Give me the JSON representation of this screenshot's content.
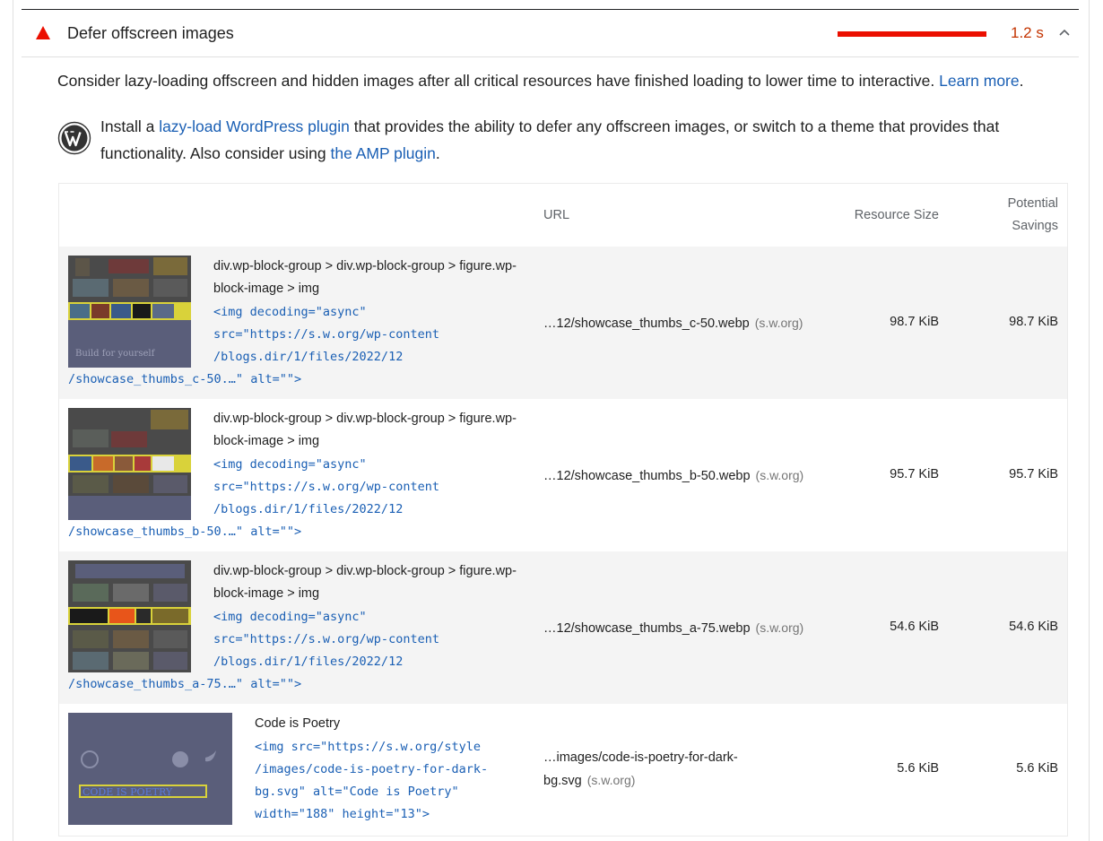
{
  "audit": {
    "title": "Defer offscreen images",
    "metric": "1.2 s",
    "description": "Consider lazy-loading offscreen and hidden images after all critical resources have finished loading to lower time to interactive.",
    "learn_more": "Learn more",
    "period": "."
  },
  "wordpress": {
    "text1": "Install a ",
    "link1": "lazy-load WordPress plugin",
    "text2": " that provides the ability to defer any offscreen images, or switch to a theme that provides that functionality. Also consider using ",
    "link2": "the AMP plugin",
    "text3": "."
  },
  "table": {
    "headers": {
      "url": "URL",
      "size": "Resource Size",
      "savings_line1": "Potential",
      "savings_line2": "Savings"
    },
    "rows": [
      {
        "selector_line1": "div.wp-block-group > div.wp-block-group > figure.wp-",
        "selector_line2": "block-image > img",
        "code_lines": [
          "<img decoding=\"async\"",
          "src=\"https://s.w.org/wp-content",
          "/blogs.dir/1/files/2022/12"
        ],
        "code_tail": "/showcase_thumbs_c-50.…\" alt=\"\">",
        "url": "…12/showcase_thumbs_c-50.webp",
        "host": "(s.w.org)",
        "size": "98.7 KiB",
        "savings": "98.7 KiB",
        "thumb_caption": "Build for yourself"
      },
      {
        "selector_line1": "div.wp-block-group > div.wp-block-group > figure.wp-",
        "selector_line2": "block-image > img",
        "code_lines": [
          "<img decoding=\"async\"",
          "src=\"https://s.w.org/wp-content",
          "/blogs.dir/1/files/2022/12"
        ],
        "code_tail": "/showcase_thumbs_b-50.…\" alt=\"\">",
        "url": "…12/showcase_thumbs_b-50.webp",
        "host": "(s.w.org)",
        "size": "95.7 KiB",
        "savings": "95.7 KiB"
      },
      {
        "selector_line1": "div.wp-block-group > div.wp-block-group > figure.wp-",
        "selector_line2": "block-image > img",
        "code_lines": [
          "<img decoding=\"async\"",
          "src=\"https://s.w.org/wp-content",
          "/blogs.dir/1/files/2022/12"
        ],
        "code_tail": "/showcase_thumbs_a-75.…\" alt=\"\">",
        "url": "…12/showcase_thumbs_a-75.webp",
        "host": "(s.w.org)",
        "size": "54.6 KiB",
        "savings": "54.6 KiB"
      },
      {
        "label": "Code is Poetry",
        "code_lines": [
          "<img src=\"https://s.w.org/style",
          "/images/code-is-poetry-for-dark-",
          "bg.svg\" alt=\"Code is Poetry\"",
          "width=\"188\" height=\"13\">"
        ],
        "url_line1": "…images/code-is-poetry-for-dark-",
        "url_line2": "bg.svg",
        "host": "(s.w.org)",
        "size": "5.6 KiB",
        "savings": "5.6 KiB",
        "thumb_caption": "CODE IS POETRY"
      }
    ]
  },
  "colors": {
    "fail": "#eb0f00",
    "metric": "#c33300",
    "link": "#1a5fb4",
    "thumb_bg": "#5a5e7a"
  }
}
